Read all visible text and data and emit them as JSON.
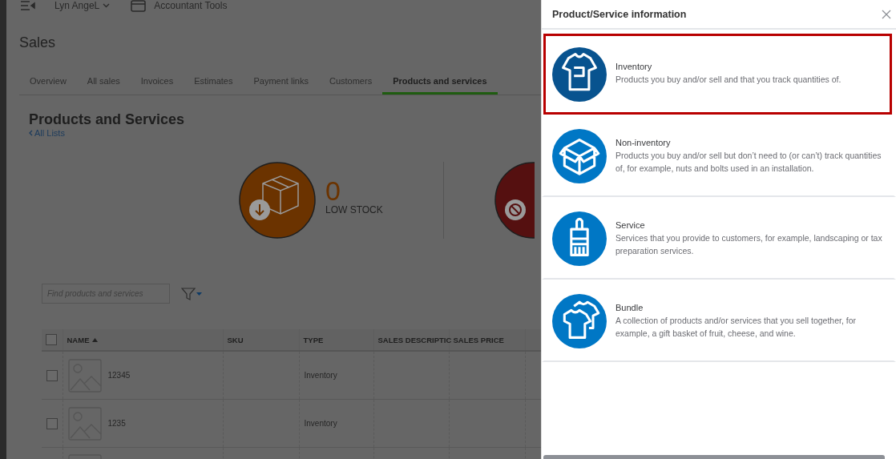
{
  "top_bar": {
    "company": "Lyn AngeL",
    "tools": "Accountant Tools"
  },
  "page": {
    "title": "Sales"
  },
  "tabs": [
    {
      "label": "Overview",
      "selected": false
    },
    {
      "label": "All sales",
      "selected": false
    },
    {
      "label": "Invoices",
      "selected": false
    },
    {
      "label": "Estimates",
      "selected": false
    },
    {
      "label": "Payment links",
      "selected": false
    },
    {
      "label": "Customers",
      "selected": false
    },
    {
      "label": "Products and services",
      "selected": true
    }
  ],
  "section": {
    "title": "Products and Services",
    "back_link": "All Lists"
  },
  "low_stock": {
    "count": "0",
    "label": "LOW STOCK"
  },
  "search": {
    "placeholder": "Find products and services"
  },
  "table": {
    "select_all_checked": false,
    "columns": [
      "NAME",
      "SKU",
      "TYPE",
      "SALES DESCRIPTIC",
      "SALES PRICE"
    ],
    "rows": [
      {
        "checked": false,
        "name": "12345",
        "type": "Inventory"
      },
      {
        "checked": false,
        "name": "1235",
        "type": "Inventory"
      }
    ]
  },
  "panel": {
    "title": "Product/Service information",
    "options": [
      {
        "kind": "inventory",
        "title": "Inventory",
        "description": "Products you buy and/or sell and that you track quantities of.",
        "selected": true
      },
      {
        "kind": "non-inventory",
        "title": "Non-inventory",
        "description": "Products you buy and/or sell but don’t need to (or can’t) track quantities of, for example, nuts and bolts used in an installation.",
        "selected": false
      },
      {
        "kind": "service",
        "title": "Service",
        "description": "Services that you provide to customers, for example, landscaping or tax preparation services.",
        "selected": false
      },
      {
        "kind": "bundle",
        "title": "Bundle",
        "description": "A collection of products and/or services that you sell together, for example, a gift basket of fruit, cheese, and wine.",
        "selected": false
      }
    ]
  }
}
